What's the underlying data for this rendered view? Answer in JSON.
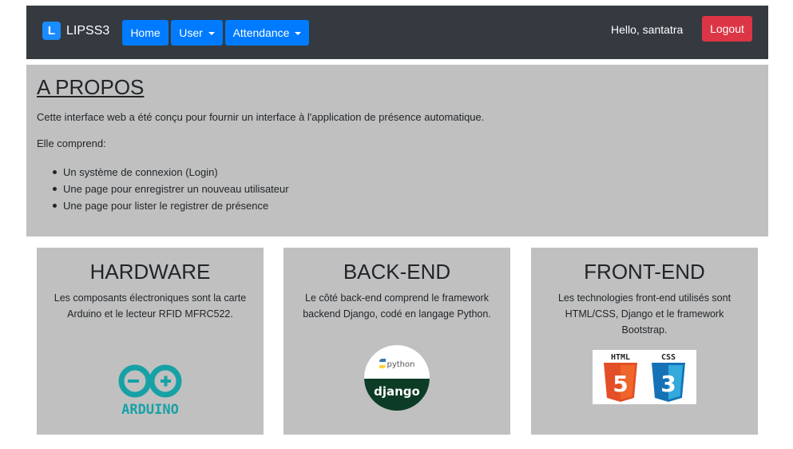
{
  "navbar": {
    "brand_letter": "L",
    "brand": "LIPSS3",
    "home": "Home",
    "user": "User",
    "attendance": "Attendance",
    "hello": "Hello, santatra",
    "logout": "Logout"
  },
  "about": {
    "title": "A PROPOS",
    "intro": "Cette interface web a été conçu pour fournir un interface à l'application de présence automatique.",
    "comprend": "Elle comprend:",
    "items": [
      "Un système de connexion (Login)",
      "Une page pour enregistrer un nouveau utilisateur",
      "Une page pour lister le registrer de présence"
    ]
  },
  "cards": [
    {
      "title": "HARDWARE",
      "text": "Les composants électroniques sont la carte Arduino et le lecteur RFID MFRC522.",
      "logo_text": "ARDUINO"
    },
    {
      "title": "BACK-END",
      "text": "Le côté back-end comprend le framework backend Django, codé en langage Python.",
      "logo_top": "python",
      "logo_bottom": "django"
    },
    {
      "title": "FRONT-END",
      "text": "Les technologies front-end utilisés sont HTML/CSS, Django et le framework Bootstrap.",
      "logo_html_label": "HTML",
      "logo_css_label": "CSS",
      "logo_html_num": "5",
      "logo_css_num": "3"
    }
  ],
  "colors": {
    "navbar_bg": "#343a40",
    "primary": "#007bff",
    "danger": "#dc3545",
    "panel_bg": "#c0c0c0",
    "arduino": "#17a1a5",
    "django": "#0c3c26",
    "html5": "#e34f26",
    "css3": "#1572b6"
  }
}
